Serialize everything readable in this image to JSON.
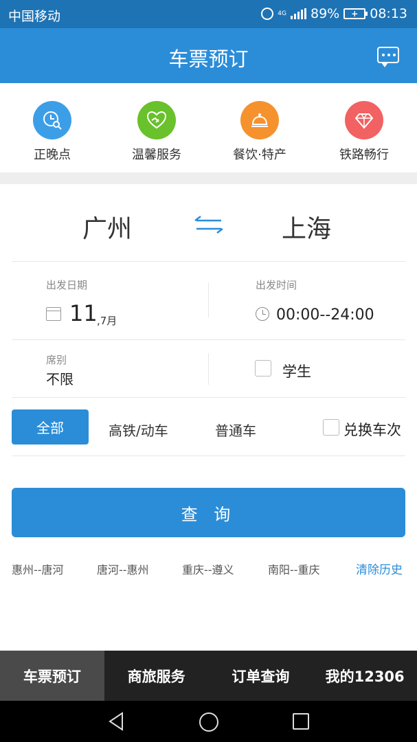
{
  "status_bar": {
    "carrier": "中国移动",
    "network": "4G",
    "battery": "89%",
    "time": "08:13"
  },
  "header": {
    "title": "车票预订",
    "message_icon": "chat-bubble-icon"
  },
  "quick_links": [
    {
      "label": "正晚点",
      "icon": "clock-search-icon",
      "color": "#3d9ee8"
    },
    {
      "label": "温馨服务",
      "icon": "heart-hands-icon",
      "color": "#69c12b"
    },
    {
      "label": "餐饮·特产",
      "icon": "food-cloche-icon",
      "color": "#f5922e"
    },
    {
      "label": "铁路畅行",
      "icon": "diamond-icon",
      "color": "#f26262"
    }
  ],
  "route": {
    "from": "广州",
    "to": "上海",
    "swap_icon": "swap-arrows-icon"
  },
  "date": {
    "label": "出发日期",
    "day": "11",
    "month": ",7月"
  },
  "time": {
    "label": "出发时间",
    "value": "00:00--24:00"
  },
  "seat": {
    "label": "席别",
    "value": "不限"
  },
  "student": {
    "label": "学生",
    "checked": false
  },
  "filters": {
    "all": "全部",
    "high_speed": "高铁/动车",
    "regular": "普通车",
    "exchange_label": "兑换车次"
  },
  "query_button": "查 询",
  "history": {
    "items": [
      "惠州--唐河",
      "唐河--惠州",
      "重庆--遵义",
      "南阳--重庆"
    ],
    "clear": "清除历史"
  },
  "bottom_nav": {
    "tabs": [
      "车票预订",
      "商旅服务",
      "订单查询",
      "我的12306"
    ],
    "active_index": 0
  },
  "colors": {
    "status_bar": "#1e73b5",
    "primary": "#2b8dd8",
    "nav_bg": "#222222",
    "nav_active": "#4a4a4a"
  }
}
